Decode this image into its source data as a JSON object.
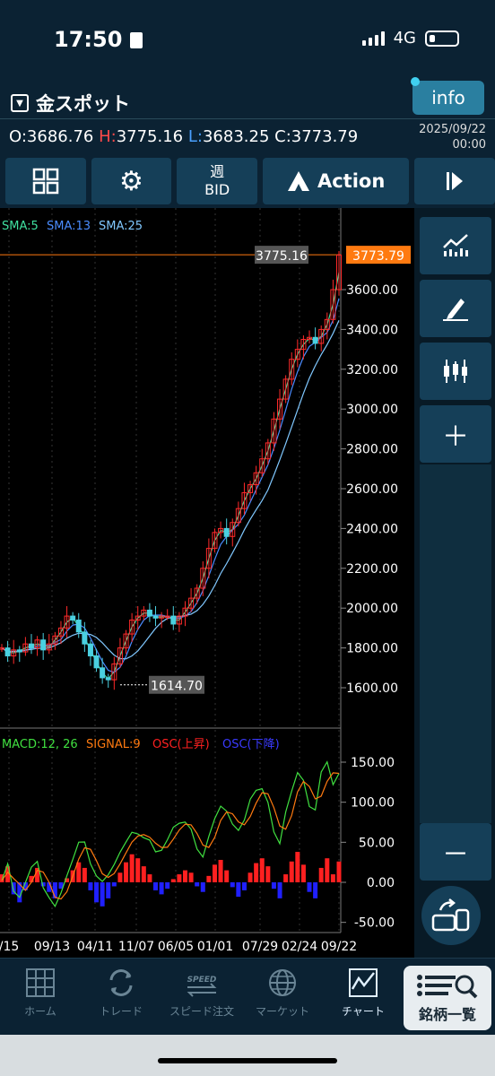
{
  "status": {
    "time": "17:50",
    "network": "4G"
  },
  "header": {
    "symbol": "金スポット",
    "info_label": "info",
    "open_label": "O:",
    "open": "3686.76",
    "high_label": "H:",
    "high": "3775.16",
    "low_label": "L:",
    "low": "3683.25",
    "close_label": "C:",
    "close": "3773.79",
    "date": "2025/09/22",
    "time": "00:00"
  },
  "toolbar": {
    "period": "週",
    "price_type": "BID",
    "action_label": "Action"
  },
  "indicators": {
    "sma5": "SMA:5",
    "sma13": "SMA:13",
    "sma25": "SMA:25",
    "macd": "MACD:12, 26",
    "signal": "SIGNAL:9",
    "osc_up": "OSC(上昇)",
    "osc_down": "OSC(下降)"
  },
  "colors": {
    "up": "#ff2a2a",
    "down": "#4ad0e0",
    "sma5": "#40e0a0",
    "sma13": "#4a8cff",
    "sma25": "#80c8ff",
    "price_tag": "#ff7a10",
    "macd": "#40e040",
    "signal": "#ff7a10",
    "osc_up": "#ff2020",
    "osc_down": "#2020ff"
  },
  "chart_data": {
    "type": "candlestick",
    "price_axis": [
      "3600.00",
      "3400.00",
      "3200.00",
      "3000.00",
      "2800.00",
      "2600.00",
      "2400.00",
      "2200.00",
      "2000.00",
      "1800.00",
      "1600.00"
    ],
    "current_price": "3773.79",
    "high_marker": "3775.16",
    "low_marker": "1614.70",
    "macd_axis": [
      "150.00",
      "100.00",
      "50.00",
      "0.00",
      "-50.00"
    ],
    "x_labels": [
      "/15",
      "09/13",
      "04/11",
      "11/07",
      "06/05",
      "01/01",
      "07/29",
      "02/24",
      "09/22"
    ],
    "close_path": [
      1800,
      1760,
      1790,
      1780,
      1820,
      1800,
      1840,
      1790,
      1820,
      1860,
      1900,
      1960,
      1940,
      1880,
      1820,
      1760,
      1700,
      1650,
      1640,
      1720,
      1800,
      1870,
      1940,
      1960,
      1990,
      1960,
      1950,
      1960,
      1960,
      1920,
      1960,
      2000,
      2050,
      2100,
      2200,
      2300,
      2380,
      2400,
      2360,
      2430,
      2500,
      2580,
      2620,
      2680,
      2750,
      2830,
      2950,
      3050,
      3150,
      3250,
      3300,
      3350,
      3360,
      3330,
      3400,
      3450,
      3600,
      3773.79
    ],
    "macd_osc": [
      10,
      20,
      -15,
      -25,
      -10,
      8,
      18,
      -5,
      -12,
      -20,
      -8,
      5,
      15,
      25,
      18,
      -10,
      -25,
      -30,
      -20,
      -5,
      12,
      25,
      35,
      30,
      20,
      10,
      -10,
      -15,
      -8,
      4,
      10,
      15,
      12,
      -5,
      -12,
      8,
      22,
      28,
      15,
      -6,
      -18,
      -10,
      12,
      24,
      30,
      20,
      -8,
      -20,
      10,
      26,
      38,
      22,
      -12,
      -20,
      18,
      30,
      10,
      26
    ]
  },
  "tabs": [
    "ホーム",
    "トレード",
    "スピード注文",
    "マーケット",
    "チャート"
  ],
  "tab_special": "銘柄一覧"
}
